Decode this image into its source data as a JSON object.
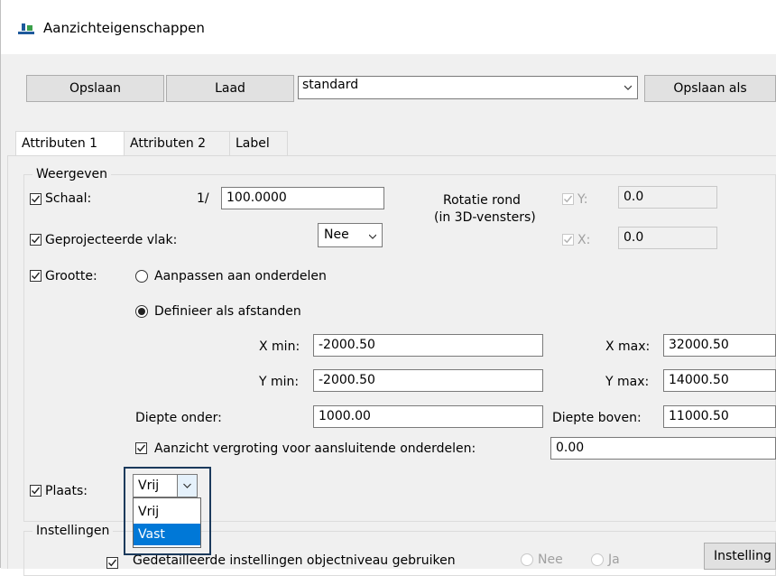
{
  "window": {
    "title": "Aanzichteigenschappen",
    "icon": "app-view-icon"
  },
  "toolbar": {
    "save_label": "Opslaan",
    "load_label": "Laad",
    "preset_value": "standard",
    "save_as_label": "Opslaan als"
  },
  "tabs": [
    {
      "label": "Attributen 1",
      "active": true
    },
    {
      "label": "Attributen 2",
      "active": false
    },
    {
      "label": "Label",
      "active": false
    }
  ],
  "display": {
    "group_label": "Weergeven",
    "scale": {
      "label": "Schaal:",
      "checked": true,
      "prefix": "1/",
      "value": "100.0000"
    },
    "rotation": {
      "label_line1": "Rotatie rond",
      "label_line2": "(in 3D-vensters)",
      "y_label": "Y:",
      "y_value": "0.0",
      "x_label": "X:",
      "x_value": "0.0"
    },
    "projected_plane": {
      "label": "Geprojecteerde vlak:",
      "checked": true,
      "value": "Nee"
    },
    "size": {
      "label": "Grootte:",
      "checked": true,
      "option_fit": "Aanpassen aan onderdelen",
      "option_define": "Definieer als afstanden",
      "selected": "define"
    },
    "extents": {
      "x_min_label": "X min:",
      "x_min": "-2000.50",
      "x_max_label": "X max:",
      "x_max": "32000.50",
      "y_min_label": "Y min:",
      "y_min": "-2000.50",
      "y_max_label": "Y max:",
      "y_max": "14000.50",
      "depth_down_label": "Diepte onder:",
      "depth_down": "1000.00",
      "depth_up_label": "Diepte boven:",
      "depth_up": "11000.50"
    },
    "view_enlargement": {
      "label": "Aanzicht vergroting voor aansluitende onderdelen:",
      "checked": true,
      "value": "0.00"
    },
    "place": {
      "label": "Plaats:",
      "checked": true,
      "value": "Vrij",
      "options": [
        "Vrij",
        "Vast"
      ],
      "highlighted": "Vast"
    }
  },
  "settings": {
    "group_label": "Instellingen",
    "detailed": {
      "label": "Gedetailleerde instellingen objectniveau gebruiken",
      "checked": true,
      "option_no": "Nee",
      "option_yes": "Ja"
    },
    "button_label": "Instelling"
  },
  "colors": {
    "selection": "#0078d7",
    "focus_border": "#1b3a5c",
    "panel_bg": "#f0f0f0"
  }
}
